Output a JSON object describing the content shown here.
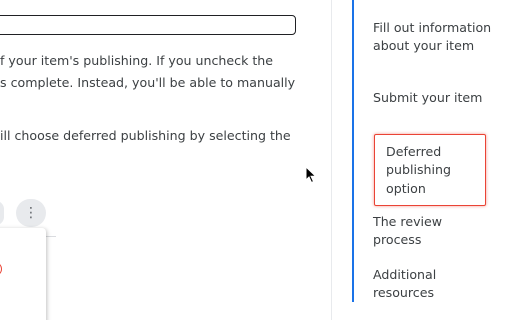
{
  "main": {
    "paragraph_1": {
      "line_1": "f your item's publishing. If you uncheck the",
      "line_2": "s complete. Instead, you'll be able to manually"
    },
    "paragraph_2": {
      "line_1": "ill choose deferred publishing by selecting the"
    }
  },
  "toc": {
    "items": [
      {
        "label": "Fill out information about your item"
      },
      {
        "label": "Submit your item"
      },
      {
        "label": "Deferred publishing option"
      },
      {
        "label": "The review process"
      },
      {
        "label": "Additional resources"
      }
    ],
    "active_index": 2
  },
  "icons": {
    "kebab": "more-vert-icon",
    "cursor": "mouse-pointer-icon"
  },
  "colors": {
    "accent": "#1a73e8",
    "highlight": "#ea4335",
    "text": "#3c4043"
  }
}
